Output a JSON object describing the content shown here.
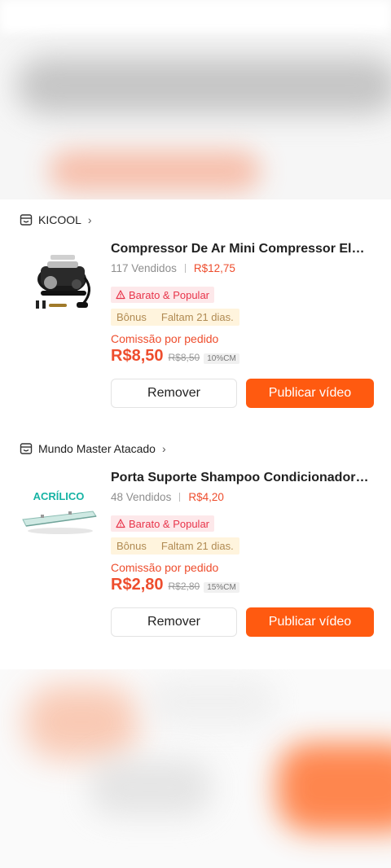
{
  "products": [
    {
      "shop_name": "KICOOL",
      "title": "Compressor De Ar Mini Compressor Elétrico",
      "sales": "117 Vendidos",
      "price": "R$12,75",
      "tag_popular": "Barato & Popular",
      "bonus_label": "Bônus",
      "bonus_time": "Faltam 21 dias.",
      "commission_label": "Comissão por pedido",
      "commission_value": "R$8,50",
      "commission_old": "R$8,50",
      "commission_rate": "10%CM",
      "remove_label": "Remover",
      "publish_label": "Publicar vídeo"
    },
    {
      "shop_name": "Mundo Master Atacado",
      "title": "Porta Suporte Shampoo Condicionador Acrílico",
      "sales": "48 Vendidos",
      "price": "R$4,20",
      "tag_popular": "Barato & Popular",
      "bonus_label": "Bônus",
      "bonus_time": "Faltam 21 dias.",
      "commission_label": "Comissão por pedido",
      "commission_value": "R$2,80",
      "commission_old": "R$2,80",
      "commission_rate": "15%CM",
      "remove_label": "Remover",
      "publish_label": "Publicar vídeo",
      "thumb_text": "ACRÍLICO"
    }
  ],
  "icons": {
    "shop": "shop-icon",
    "chevron": "chevron-right-icon",
    "warning": "warning-triangle-icon"
  },
  "colors": {
    "accent": "#ee4d2d",
    "publish_button": "#ff5a10",
    "popular_tag_bg": "#fde8ea",
    "bonus_tag_bg": "#fff4dd"
  }
}
